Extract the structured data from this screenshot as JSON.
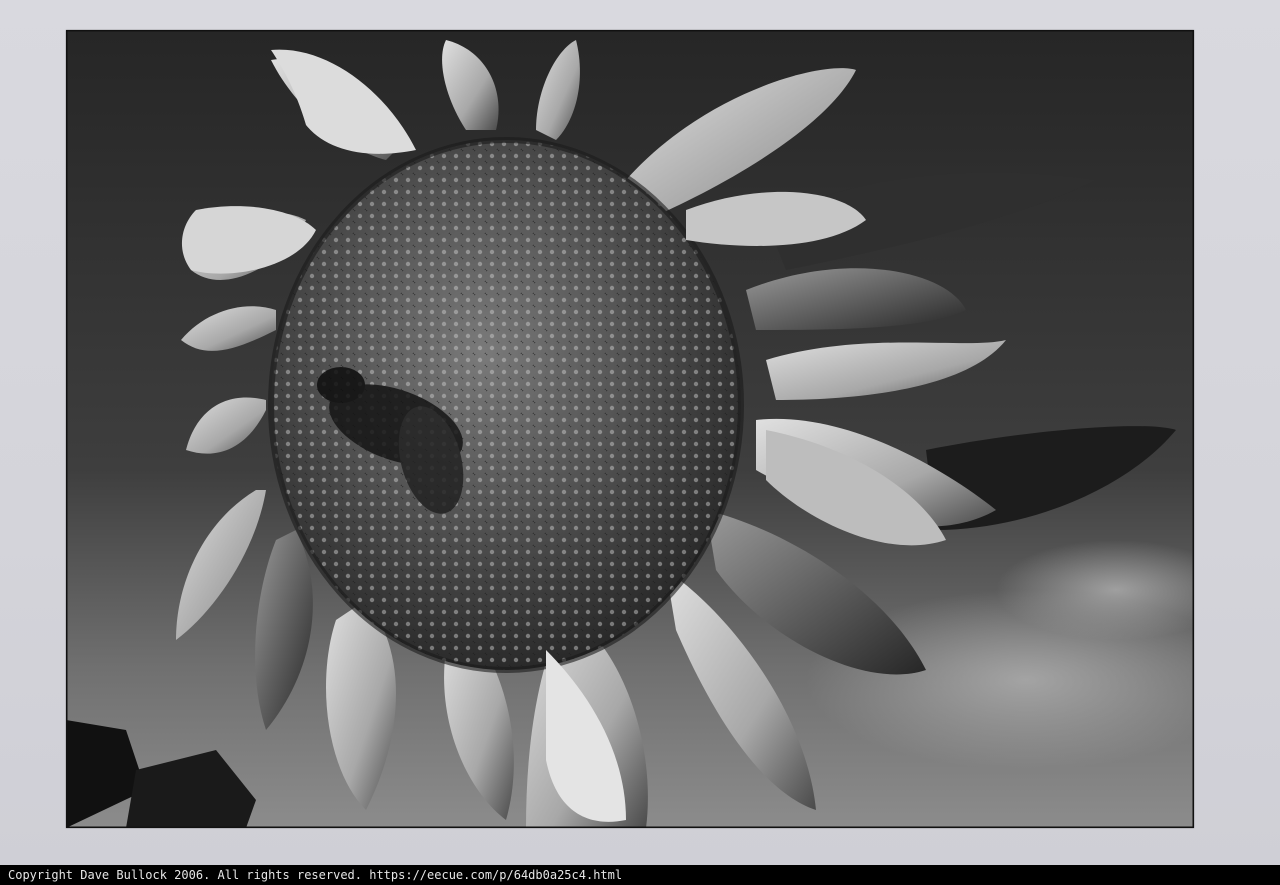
{
  "photo": {
    "subject": "sunflower-with-bee",
    "palette": {
      "sky_dark": "#2b2b2b",
      "sky_light": "#8f8f8f",
      "mat": "#d6d6dc",
      "petal_light": "#d0d0d0",
      "petal_dark": "#3a3a3a",
      "disc": "#4a4a4a"
    }
  },
  "footer": {
    "copyright": "Copyright Dave Bullock 2006. All rights reserved. https://eecue.com/p/64db0a25c4.html"
  }
}
